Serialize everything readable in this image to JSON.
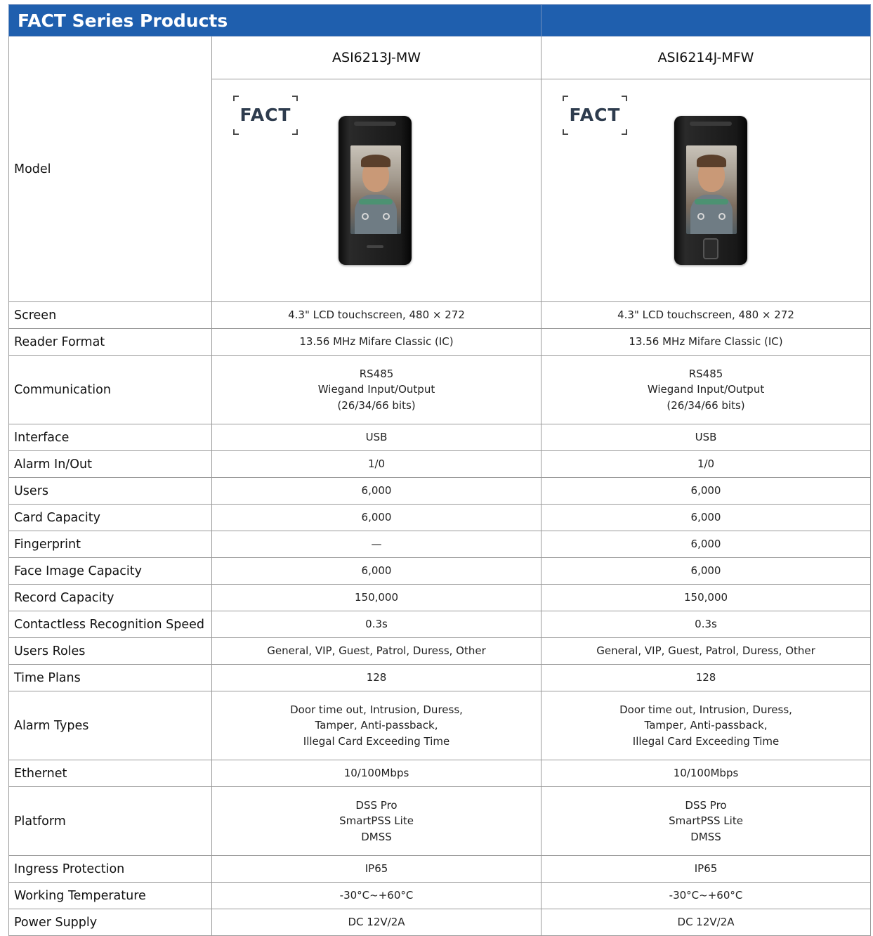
{
  "header": {
    "title": "FACT Series Products"
  },
  "logo_text": "FACT",
  "icons": {
    "product_logo": "fact-logo",
    "device": "face-access-terminal-image"
  },
  "models": [
    "ASI6213J-MW",
    "ASI6214J-MFW"
  ],
  "model_label": "Model",
  "specs": [
    {
      "label": "Screen",
      "values": [
        "4.3\" LCD touchscreen, 480 × 272",
        "4.3\" LCD touchscreen, 480 × 272"
      ]
    },
    {
      "label": "Reader Format",
      "values": [
        "13.56 MHz Mifare Classic (IC)",
        "13.56 MHz Mifare Classic (IC)"
      ]
    },
    {
      "label": "Communication",
      "values": [
        "RS485\nWiegand Input/Output\n(26/34/66 bits)",
        "RS485\nWiegand Input/Output\n(26/34/66 bits)"
      ]
    },
    {
      "label": "Interface",
      "values": [
        "USB",
        "USB"
      ]
    },
    {
      "label": "Alarm In/Out",
      "values": [
        "1/0",
        "1/0"
      ]
    },
    {
      "label": "Users",
      "values": [
        "6,000",
        "6,000"
      ]
    },
    {
      "label": "Card Capacity",
      "values": [
        "6,000",
        "6,000"
      ]
    },
    {
      "label": "Fingerprint",
      "values": [
        "—",
        "6,000"
      ]
    },
    {
      "label": "Face Image Capacity",
      "values": [
        "6,000",
        "6,000"
      ]
    },
    {
      "label": "Record Capacity",
      "values": [
        "150,000",
        "150,000"
      ]
    },
    {
      "label": "Contactless Recognition Speed",
      "values": [
        "0.3s",
        "0.3s"
      ]
    },
    {
      "label": "Users Roles",
      "values": [
        "General, VIP, Guest, Patrol, Duress, Other",
        "General, VIP, Guest, Patrol, Duress, Other"
      ]
    },
    {
      "label": "Time Plans",
      "values": [
        "128",
        "128"
      ]
    },
    {
      "label": "Alarm Types",
      "values": [
        "Door time out, Intrusion, Duress,\nTamper, Anti-passback,\nIllegal Card Exceeding Time",
        "Door time out, Intrusion, Duress,\nTamper, Anti-passback,\nIllegal Card Exceeding Time"
      ]
    },
    {
      "label": "Ethernet",
      "values": [
        "10/100Mbps",
        "10/100Mbps"
      ]
    },
    {
      "label": "Platform",
      "values": [
        "DSS Pro\nSmartPSS Lite\nDMSS",
        "DSS Pro\nSmartPSS Lite\nDMSS"
      ]
    },
    {
      "label": "Ingress Protection",
      "values": [
        "IP65",
        "IP65"
      ]
    },
    {
      "label": "Working Temperature",
      "values": [
        "-30°C~+60°C",
        "-30°C~+60°C"
      ]
    },
    {
      "label": "Power Supply",
      "values": [
        "DC 12V/2A",
        "DC 12V/2A"
      ]
    }
  ]
}
